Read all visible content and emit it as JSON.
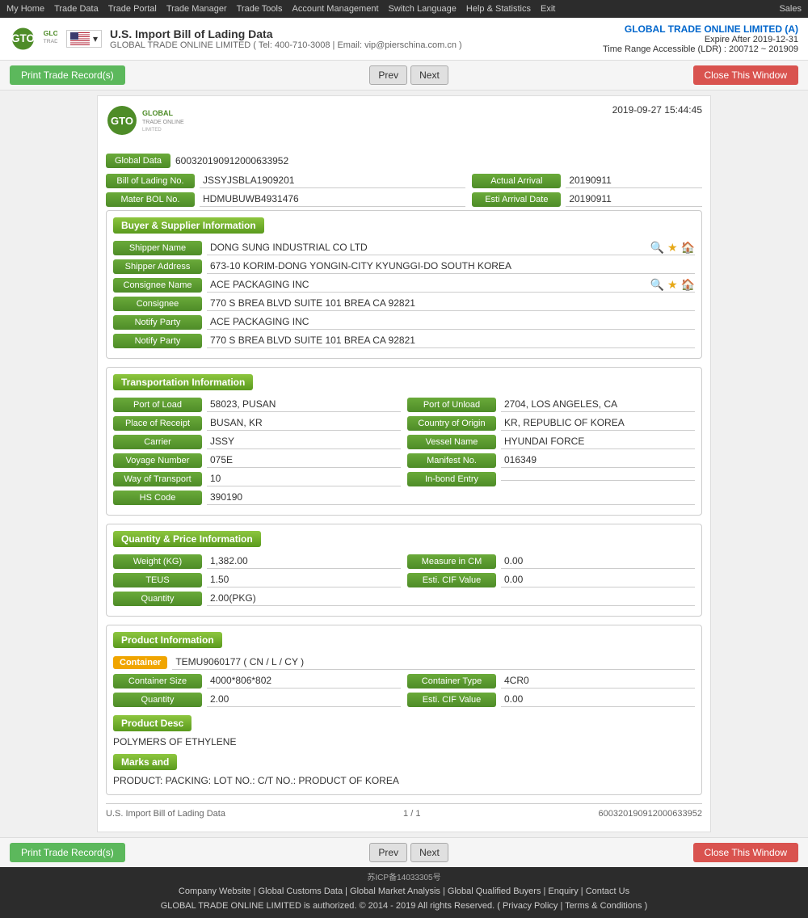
{
  "topNav": {
    "items": [
      "My Home",
      "Trade Data",
      "Trade Portal",
      "Trade Manager",
      "Trade Tools",
      "Account Management",
      "Switch Language",
      "Help & Statistics",
      "Exit"
    ],
    "sales": "Sales"
  },
  "header": {
    "titleLine": "U.S. Import Bill of Lading Data",
    "contact": "GLOBAL TRADE ONLINE LIMITED ( Tel: 400-710-3008 | Email: vip@pierschina.com.cn )",
    "company": "GLOBAL TRADE ONLINE LIMITED (A)",
    "expire": "Expire After 2019-12-31",
    "range": "Time Range Accessible (LDR) : 200712 ~ 201909"
  },
  "actionBar": {
    "print": "Print Trade Record(s)",
    "prev": "Prev",
    "next": "Next",
    "close": "Close This Window"
  },
  "record": {
    "timestamp": "2019-09-27 15:44:45",
    "globalDataLabel": "Global Data",
    "globalDataValue": "600320190912000633952",
    "bolLabel": "Bill of Lading No.",
    "bolValue": "JSSYJSBLA1909201",
    "actualArrivalLabel": "Actual Arrival",
    "actualArrivalValue": "20190911",
    "masterBolLabel": "Mater BOL No.",
    "masterBolValue": "HDMUBUWB4931476",
    "estiArrivalLabel": "Esti Arrival Date",
    "estiArrivalValue": "20190911"
  },
  "buyerSupplier": {
    "sectionTitle": "Buyer & Supplier Information",
    "shipperNameLabel": "Shipper Name",
    "shipperNameValue": "DONG SUNG INDUSTRIAL CO LTD",
    "shipperAddressLabel": "Shipper Address",
    "shipperAddressValue": "673-10 KORIM-DONG YONGIN-CITY KYUNGGI-DO SOUTH KOREA",
    "consigneeNameLabel": "Consignee Name",
    "consigneeNameValue": "ACE PACKAGING INC",
    "consigneeLabel": "Consignee",
    "consigneeValue": "770 S BREA BLVD SUITE 101 BREA CA 92821",
    "notifyPartyLabel": "Notify Party",
    "notifyPartyValue1": "ACE PACKAGING INC",
    "notifyPartyValue2": "770 S BREA BLVD SUITE 101 BREA CA 92821"
  },
  "transportation": {
    "sectionTitle": "Transportation Information",
    "portOfLoadLabel": "Port of Load",
    "portOfLoadValue": "58023, PUSAN",
    "portOfUnloadLabel": "Port of Unload",
    "portOfUnloadValue": "2704, LOS ANGELES, CA",
    "placeOfReceiptLabel": "Place of Receipt",
    "placeOfReceiptValue": "BUSAN, KR",
    "countryOfOriginLabel": "Country of Origin",
    "countryOfOriginValue": "KR, REPUBLIC OF KOREA",
    "carrierLabel": "Carrier",
    "carrierValue": "JSSY",
    "vesselNameLabel": "Vessel Name",
    "vesselNameValue": "HYUNDAI FORCE",
    "voyageNumberLabel": "Voyage Number",
    "voyageNumberValue": "075E",
    "manifestNoLabel": "Manifest No.",
    "manifestNoValue": "016349",
    "wayOfTransportLabel": "Way of Transport",
    "wayOfTransportValue": "10",
    "inBondEntryLabel": "In-bond Entry",
    "inBondEntryValue": "",
    "hsCodeLabel": "HS Code",
    "hsCodeValue": "390190"
  },
  "quantityPrice": {
    "sectionTitle": "Quantity & Price Information",
    "weightLabel": "Weight (KG)",
    "weightValue": "1,382.00",
    "measureLabel": "Measure in CM",
    "measureValue": "0.00",
    "teusLabel": "TEUS",
    "teusValue": "1.50",
    "estiCifLabel": "Esti. CIF Value",
    "estiCifValue": "0.00",
    "quantityLabel": "Quantity",
    "quantityValue": "2.00(PKG)"
  },
  "productInfo": {
    "sectionTitle": "Product Information",
    "containerLabel": "Container",
    "containerBadge": "Container",
    "containerValue": "TEMU9060177 ( CN / L / CY )",
    "containerSizeLabel": "Container Size",
    "containerSizeValue": "4000*806*802",
    "containerTypeLabel": "Container Type",
    "containerTypeValue": "4CR0",
    "quantityLabel": "Quantity",
    "quantityValue": "2.00",
    "estiCifLabel": "Esti. CIF Value",
    "estiCifValue": "0.00",
    "productDescLabel": "Product Desc",
    "productDescValue": "POLYMERS OF ETHYLENE",
    "marksLabel": "Marks and",
    "marksValue": "PRODUCT: PACKING: LOT NO.: C/T NO.: PRODUCT OF KOREA"
  },
  "recordFooter": {
    "pageTitle": "U.S. Import Bill of Lading Data",
    "pageNumber": "1 / 1",
    "recordId": "600320190912000633952"
  },
  "footer": {
    "icp": "苏ICP备14033305号",
    "links": "Company Website | Global Customs Data | Global Market Analysis | Global Qualified Buyers | Enquiry | Contact Us",
    "copyright": "GLOBAL TRADE ONLINE LIMITED is authorized. © 2014 - 2019 All rights Reserved.  ( Privacy Policy | Terms & Conditions )"
  }
}
